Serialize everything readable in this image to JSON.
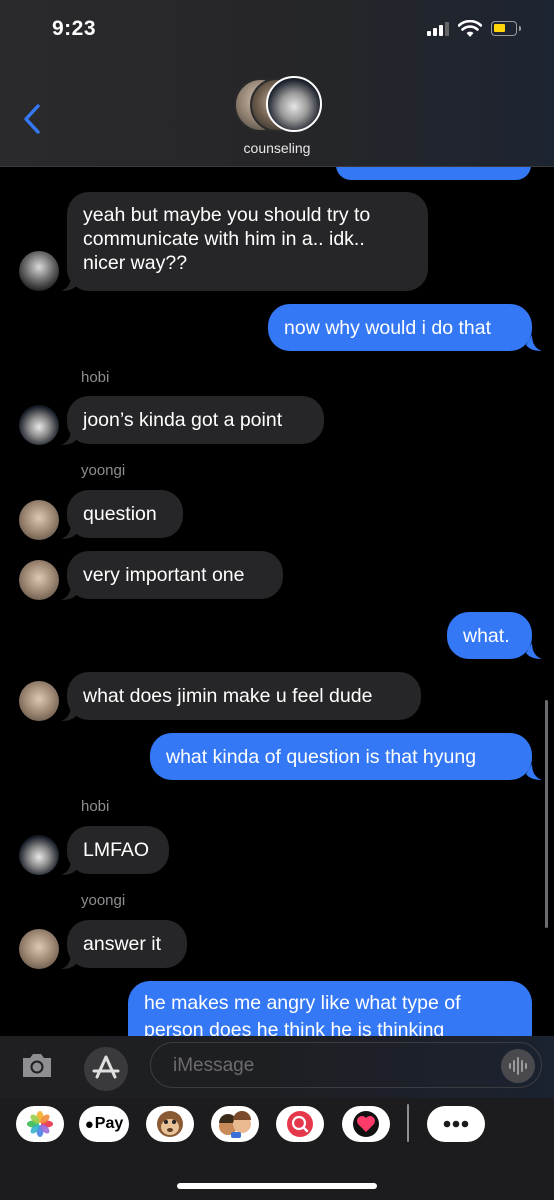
{
  "status_bar": {
    "time": "9:23"
  },
  "header": {
    "group_name": "counseling"
  },
  "messages": [
    {
      "sender": "",
      "text": "yeah but maybe you should try to communicate with him in a.. idk.. nicer way??"
    },
    {
      "text": "now why would i do that"
    },
    {
      "sender": "hobi",
      "text": "joon’s kinda got a point"
    },
    {
      "sender": "yoongi",
      "text": "question"
    },
    {
      "text": "very important one"
    },
    {
      "text": "what."
    },
    {
      "text": "what does jimin make u feel dude"
    },
    {
      "text": "what kinda of question is that hyung"
    },
    {
      "sender": "hobi",
      "text": "LMFAO"
    },
    {
      "sender": "yoongi",
      "text": "answer it"
    },
    {
      "text": "he makes me angry like what type of person does he think he is thinking"
    }
  ],
  "input": {
    "placeholder": "iMessage"
  },
  "drawer": {
    "apple_pay_label": "Pay"
  },
  "colors": {
    "outgoing": "#3478f6",
    "incoming": "#262628",
    "battery": "#ffd60a"
  },
  "icons": [
    "back-chevron-icon",
    "camera-icon",
    "app-store-icon",
    "audio-waveform-icon",
    "photos-icon",
    "apple-pay-icon",
    "animoji-icon",
    "memoji-icon",
    "web-search-icon",
    "digital-touch-icon",
    "more-icon"
  ]
}
